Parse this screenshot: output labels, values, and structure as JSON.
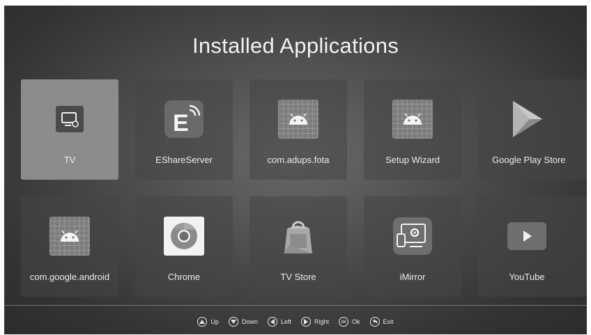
{
  "title": "Installed Applications",
  "apps": [
    {
      "label": "TV",
      "icon": "tv-settings-icon"
    },
    {
      "label": "EShareServer",
      "icon": "eshare-icon"
    },
    {
      "label": "com.adups.fota",
      "icon": "android-icon"
    },
    {
      "label": "Setup Wizard",
      "icon": "android-icon"
    },
    {
      "label": "Google Play Store",
      "icon": "google-play-icon"
    },
    {
      "label": "com.google.android",
      "icon": "android-icon"
    },
    {
      "label": "Chrome",
      "icon": "chrome-icon"
    },
    {
      "label": "TV Store",
      "icon": "shopping-bag-icon"
    },
    {
      "label": "iMirror",
      "icon": "imirror-icon"
    },
    {
      "label": "YouTube",
      "icon": "youtube-icon"
    }
  ],
  "footer": {
    "up": "Up",
    "down": "Down",
    "left": "Left",
    "right": "Right",
    "ok": "Ok",
    "ok_symbol": "ok",
    "exit": "Exit"
  }
}
